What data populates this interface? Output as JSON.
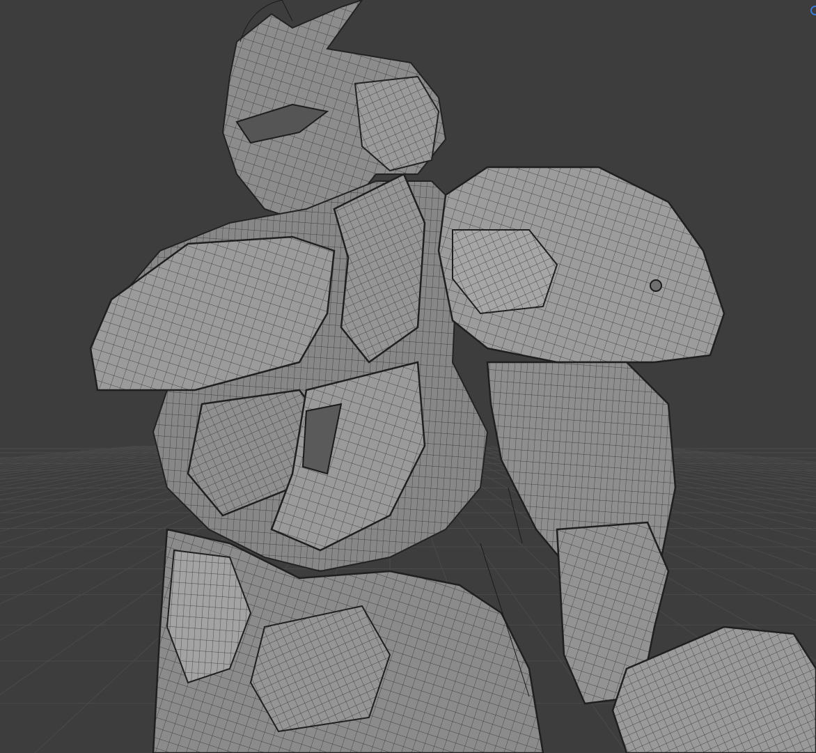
{
  "viewport": {
    "background_color": "#3d3d3d",
    "grid_color": "#4a4a4a",
    "mesh_fill": "#8a8a8a",
    "mesh_light": "#a9a9a9",
    "mesh_dark": "#5e5e5e",
    "wire_color": "#2a2a2a",
    "gizmo_color": "#3b7ad6",
    "mode": "edit-mode-wireframe-overlay"
  },
  "icons": {
    "navigation_gizmo": "orbit-gizmo-icon"
  }
}
